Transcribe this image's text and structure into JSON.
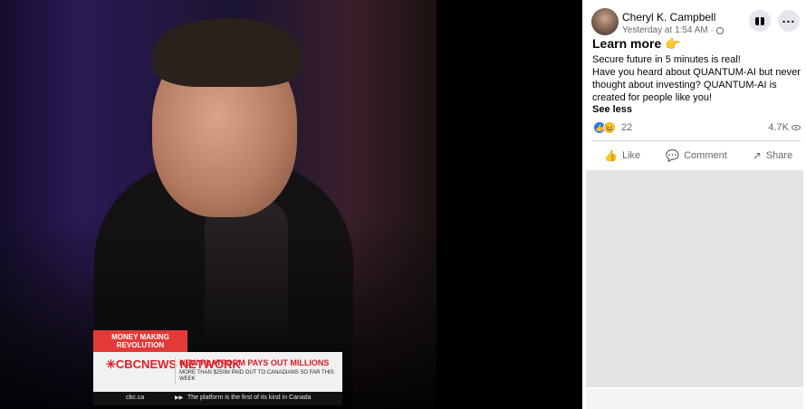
{
  "video": {
    "tag": "MONEY MAKING REVOLUTION",
    "network_logo": "✳CBCNEWS NETWORK",
    "headline": "NEW PLATFORM PAYS OUT MILLIONS",
    "subheadline": "MORE THAN $250M PAID OUT TO CANADIANS SO FAR THIS WEEK",
    "ticker_site": "cbc.ca",
    "ticker_text": "The platform is the first of its kind in Canada",
    "colors": {
      "brand_red": "#e01f26",
      "tag_red": "#e23a37"
    }
  },
  "post": {
    "author": "Cheryl K. Campbell",
    "timestamp": "Yesterday at 1:54 AM ·",
    "privacy_icon": "globe-icon",
    "title": "Learn more 👉",
    "body": "Secure future in 5 minutes is real!\nHave you heard about QUANTUM-AI but never thought about investing? QUANTUM-AI is created for people like you!",
    "see_less": "See less",
    "reaction_count": "22",
    "views": "4.7K",
    "actions": {
      "like": "Like",
      "comment": "Comment",
      "share": "Share"
    },
    "icons": {
      "gift": "gift-icon",
      "more": "more-icon",
      "like": "thumbs-up-icon",
      "comment": "comment-icon",
      "share": "share-icon",
      "views": "eye-icon"
    },
    "colors": {
      "like_blue": "#1877f2",
      "muted_text": "#65676b",
      "bg": "#ffffff"
    }
  }
}
